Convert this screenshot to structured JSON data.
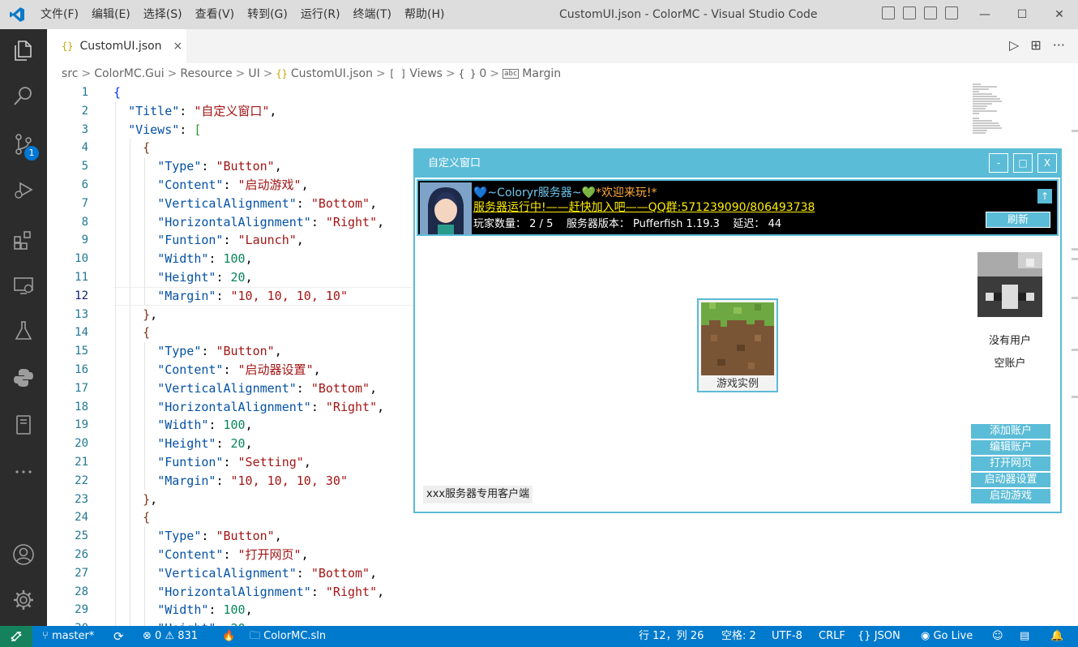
{
  "window": {
    "title": "CustomUI.json - ColorMC - Visual Studio Code",
    "minimize": "—",
    "maximize": "☐",
    "close": "✕"
  },
  "menu": [
    "文件(F)",
    "编辑(E)",
    "选择(S)",
    "查看(V)",
    "转到(G)",
    "运行(R)",
    "终端(T)",
    "帮助(H)"
  ],
  "activity": {
    "scm_badge": "1"
  },
  "tab": {
    "braces": "{}",
    "name": "CustomUI.json",
    "close": "×"
  },
  "tab_actions": {
    "run": "▷",
    "split": "⊞",
    "more": "···"
  },
  "breadcrumb": [
    {
      "icon": "",
      "label": "src"
    },
    {
      "icon": "",
      "label": "ColorMC.Gui"
    },
    {
      "icon": "",
      "label": "Resource"
    },
    {
      "icon": "",
      "label": "UI"
    },
    {
      "icon": "{}",
      "label": "CustomUI.json"
    },
    {
      "icon": "[ ]",
      "label": "Views"
    },
    {
      "icon": "{ }",
      "label": "0"
    },
    {
      "icon": "abc",
      "label": "Margin"
    }
  ],
  "editor": {
    "line_numbers": [
      "1",
      "2",
      "3",
      "4",
      "5",
      "6",
      "7",
      "8",
      "9",
      "10",
      "11",
      "12",
      "13",
      "14",
      "15",
      "16",
      "17",
      "18",
      "19",
      "20",
      "21",
      "22",
      "23",
      "24",
      "25",
      "26",
      "27",
      "28",
      "29",
      "30"
    ],
    "active_line": "12"
  },
  "overlay": {
    "title": "自定义窗口",
    "btn_min": "-",
    "btn_max": "□",
    "btn_close": "X",
    "motd_line1_a": "💙~Coloryr服务器~",
    "motd_line1_b": "💚",
    "motd_line1_c": "*欢迎来玩!*",
    "motd_line2": "服务器运行中!——赶快加入吧——QQ群:571239090/806493738",
    "players_label": "玩家数量：",
    "players_value": "2 / 5",
    "version_label": "服务器版本：",
    "version_value": "Pufferfish 1.19.3",
    "ping_label": "延迟：",
    "ping_value": "44",
    "up_icon": "↑",
    "refresh": "刷新",
    "game_label": "游戏实例",
    "user_name": "没有用户",
    "user_type": "空账户",
    "buttons": [
      "添加账户",
      "编辑账户",
      "打开网页",
      "启动器设置",
      "启动游戏"
    ],
    "footer": "xxx服务器专用客户端"
  },
  "status": {
    "remote": "><",
    "branch": "master*",
    "sync": "⟳",
    "errors": "0",
    "warnings": "831",
    "flame": "🔥",
    "solution": "ColorMC.sln",
    "position": "行 12，列 26",
    "spaces": "空格: 2",
    "encoding": "UTF-8",
    "eol": "CRLF",
    "language": "JSON",
    "golive": "Go Live"
  },
  "colors": {
    "accent": "#5bbcd7",
    "statusbar": "#007acc",
    "activitybar": "#2c2c2c"
  }
}
